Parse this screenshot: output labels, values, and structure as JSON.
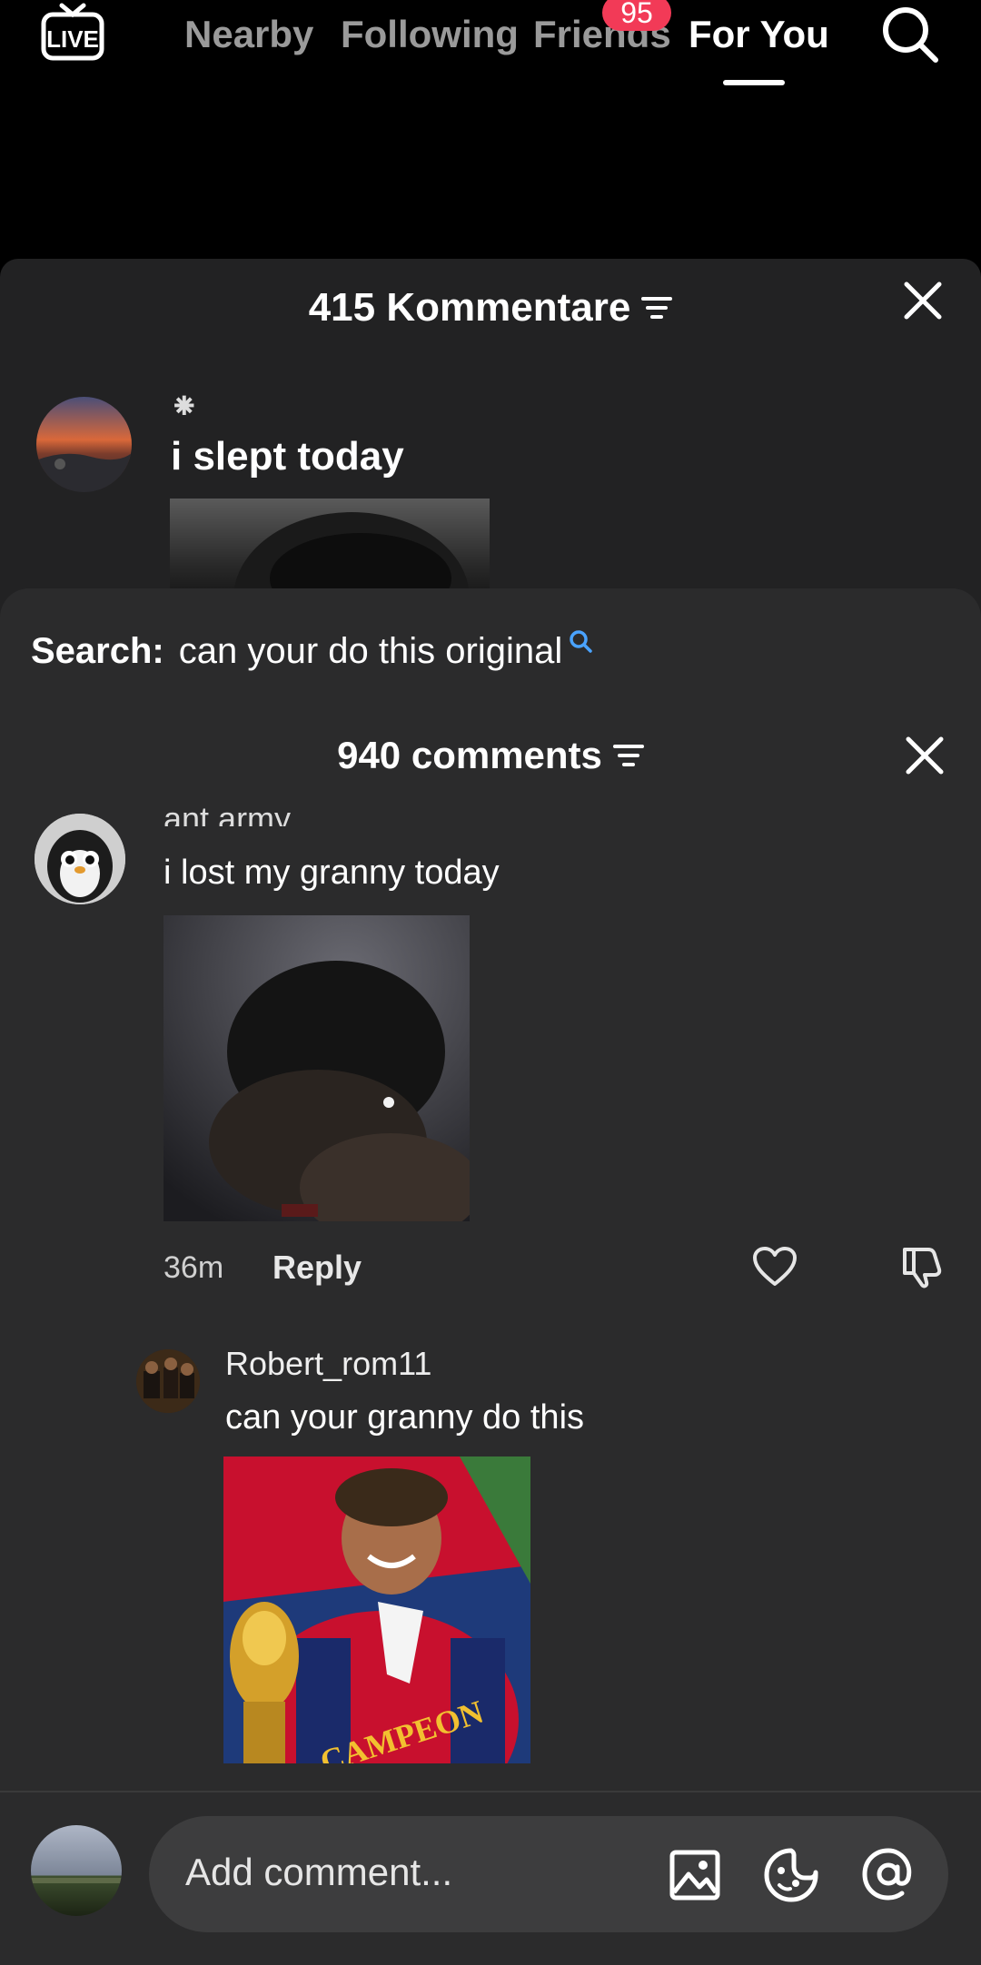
{
  "nav": {
    "tabs": [
      {
        "label": "Nearby"
      },
      {
        "label": "Following"
      },
      {
        "label": "Friends"
      },
      {
        "label": "For You"
      }
    ],
    "friends_badge": "95",
    "live_label": "LIVE"
  },
  "back_sheet": {
    "title": "415 Kommentare",
    "comment_marker": "⁕",
    "comment_text": "i slept today"
  },
  "front_sheet": {
    "search_label": "Search:",
    "search_query": "can your do this original",
    "title": "940 comments",
    "comment": {
      "username": "ant army",
      "text": "i lost my granny today",
      "time": "36m",
      "reply_label": "Reply"
    },
    "reply": {
      "username": "Robert_rom11",
      "text": "can your granny do this",
      "gif_caption": "CAMPEON"
    }
  },
  "input_bar": {
    "placeholder": "Add comment..."
  },
  "colors": {
    "badge": "#f23a57",
    "sheet_bg": "#2b2b2c",
    "search_icon_blue": "#4aa3ff"
  }
}
